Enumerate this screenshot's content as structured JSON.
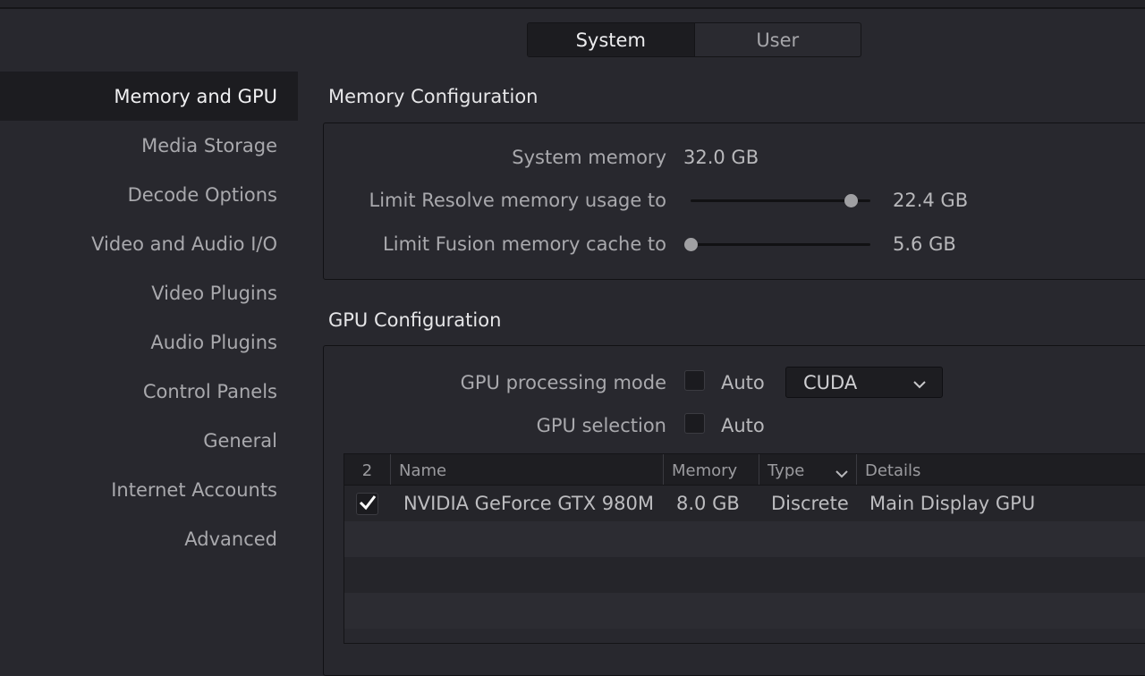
{
  "tabs": [
    {
      "label": "System",
      "active": true
    },
    {
      "label": "User",
      "active": false
    }
  ],
  "sidebar": {
    "items": [
      {
        "label": "Memory and GPU",
        "active": true
      },
      {
        "label": "Media Storage"
      },
      {
        "label": "Decode Options"
      },
      {
        "label": "Video and Audio I/O"
      },
      {
        "label": "Video Plugins"
      },
      {
        "label": "Audio Plugins"
      },
      {
        "label": "Control Panels"
      },
      {
        "label": "General"
      },
      {
        "label": "Internet Accounts"
      },
      {
        "label": "Advanced"
      }
    ]
  },
  "memory": {
    "title": "Memory Configuration",
    "system_memory_label": "System memory",
    "system_memory_value": "32.0 GB",
    "resolve_limit_label": "Limit Resolve memory usage to",
    "resolve_limit_value": "22.4 GB",
    "resolve_limit_fraction": 0.89,
    "fusion_limit_label": "Limit Fusion memory cache to",
    "fusion_limit_value": "5.6 GB",
    "fusion_limit_fraction": 0.0
  },
  "gpu": {
    "title": "GPU Configuration",
    "processing_mode_label": "GPU processing mode",
    "processing_auto_label": "Auto",
    "processing_auto_checked": false,
    "processing_mode_value": "CUDA",
    "selection_label": "GPU selection",
    "selection_auto_label": "Auto",
    "selection_auto_checked": false,
    "table": {
      "columns": [
        "2",
        "Name",
        "Memory",
        "Type",
        "Details"
      ],
      "rows": [
        {
          "checked": true,
          "name": "NVIDIA GeForce GTX 980M",
          "memory": "8.0 GB",
          "type": "Discrete",
          "details": "Main Display GPU"
        }
      ]
    }
  },
  "colors": {
    "background": "#28282e",
    "active_background": "#1c1c20",
    "text": "#a9a9ad"
  },
  "icons": {
    "dropdown": "chevron-down-icon",
    "column_sort": "chevron-down-icon",
    "row_check": "checkmark-icon"
  }
}
